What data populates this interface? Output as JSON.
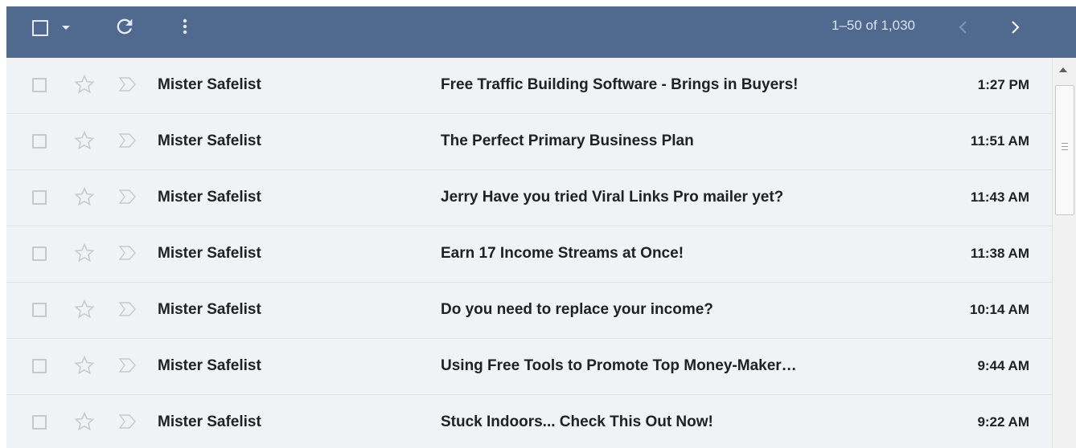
{
  "toolbar": {
    "count_text": "1–50 of 1,030",
    "icons": [
      "checkbox-icon",
      "dropdown-caret-icon",
      "refresh-icon",
      "more-vert-icon",
      "chevron-left-icon",
      "chevron-right-icon"
    ]
  },
  "colors": {
    "toolbar_bg": "#4f6a8e",
    "row_bg": "#f1f2f6",
    "text": "#202124",
    "icon_gray": "#c6c8cc"
  },
  "emails": [
    {
      "sender": "Mister Safelist",
      "subject": "Free Traffic Building Software - Brings in Buyers!",
      "time": "1:27 PM"
    },
    {
      "sender": "Mister Safelist",
      "subject": "The Perfect Primary Business Plan",
      "time": "11:51 AM"
    },
    {
      "sender": "Mister Safelist",
      "subject": "Jerry Have you tried Viral Links Pro mailer yet?",
      "time": "11:43 AM"
    },
    {
      "sender": "Mister Safelist",
      "subject": "Earn 17 Income Streams at Once!",
      "time": "11:38 AM"
    },
    {
      "sender": "Mister Safelist",
      "subject": "Do you need to replace your income?",
      "time": "10:14 AM"
    },
    {
      "sender": "Mister Safelist",
      "subject": "Using Free Tools to Promote Top Money-Maker…",
      "time": "9:44 AM"
    },
    {
      "sender": "Mister Safelist",
      "subject": "Stuck Indoors... Check This Out Now!",
      "time": "9:22 AM"
    }
  ]
}
